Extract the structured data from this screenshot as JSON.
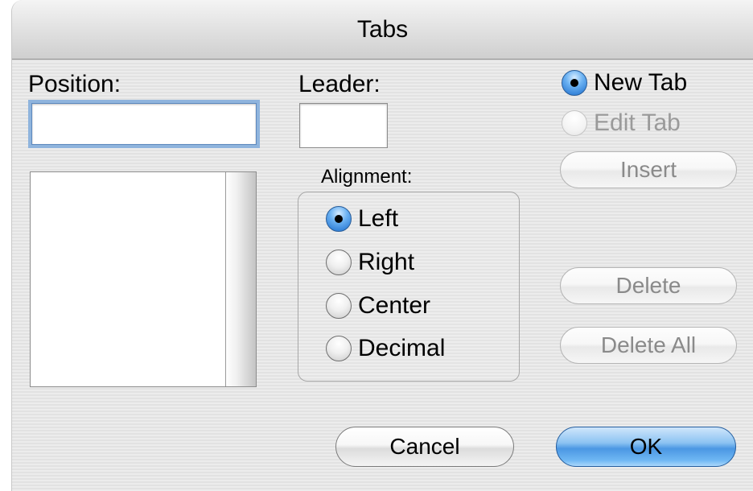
{
  "window": {
    "title": "Tabs"
  },
  "position": {
    "label": "Position:",
    "value": ""
  },
  "leader": {
    "label": "Leader:",
    "value": ""
  },
  "tab_list": {
    "items": []
  },
  "alignment": {
    "label": "Alignment:",
    "selected": "Left",
    "options": [
      "Left",
      "Right",
      "Center",
      "Decimal"
    ]
  },
  "tab_mode": {
    "selected": "New Tab",
    "options": [
      {
        "label": "New Tab",
        "enabled": true
      },
      {
        "label": "Edit Tab",
        "enabled": false
      }
    ]
  },
  "buttons": {
    "insert": "Insert",
    "delete": "Delete",
    "delete_all": "Delete All",
    "cancel": "Cancel",
    "ok": "OK"
  }
}
